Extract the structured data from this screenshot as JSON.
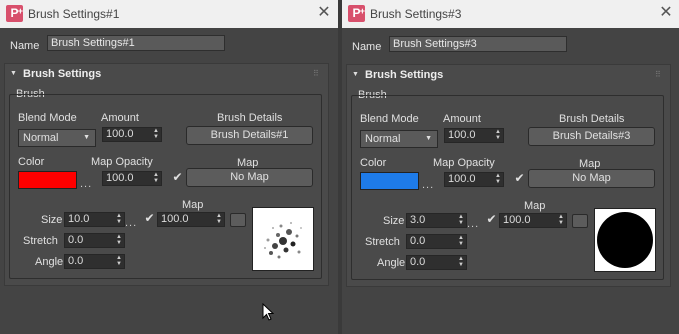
{
  "left": {
    "title": "Brush Settings#1",
    "name_label": "Name",
    "name_value": "Brush Settings#1",
    "rollout_title": "Brush Settings",
    "group_label": "Brush",
    "blend_mode_label": "Blend Mode",
    "blend_mode_value": "Normal",
    "amount_label": "Amount",
    "amount_value": "100.0",
    "brush_details_label": "Brush Details",
    "brush_details_button": "Brush Details#1",
    "color_label": "Color",
    "color_value": "#ff0000",
    "map_opacity_label": "Map Opacity",
    "map_opacity_value": "100.0",
    "map_label": "Map",
    "map_button": "No Map",
    "map2_label": "Map",
    "size_label": "Size",
    "size_value": "10.0",
    "size_map_value": "100.0",
    "stretch_label": "Stretch",
    "stretch_value": "0.0",
    "angle_label": "Angle",
    "angle_value": "0.0",
    "dots": "..."
  },
  "right": {
    "title": "Brush Settings#3",
    "name_label": "Name",
    "name_value": "Brush Settings#3",
    "rollout_title": "Brush Settings",
    "group_label": "Brush",
    "blend_mode_label": "Blend Mode",
    "blend_mode_value": "Normal",
    "amount_label": "Amount",
    "amount_value": "100.0",
    "brush_details_label": "Brush Details",
    "brush_details_button": "Brush Details#3",
    "color_label": "Color",
    "color_value": "#1e7be8",
    "map_opacity_label": "Map Opacity",
    "map_opacity_value": "100.0",
    "map_label": "Map",
    "map_button": "No Map",
    "map2_label": "Map",
    "size_label": "Size",
    "size_value": "3.0",
    "size_map_value": "100.0",
    "stretch_label": "Stretch",
    "stretch_value": "0.0",
    "angle_label": "Angle",
    "angle_value": "0.0",
    "dots": "..."
  }
}
